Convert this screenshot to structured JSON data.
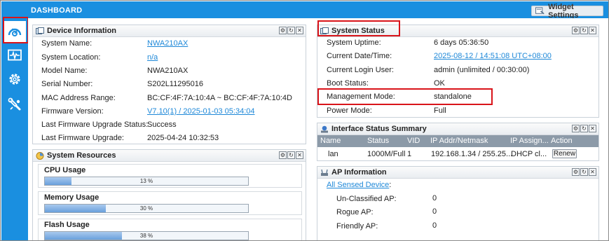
{
  "header": {
    "title": "DASHBOARD",
    "widget_settings_label": "Widget Settings"
  },
  "sidebar": {
    "items": [
      {
        "name": "dashboard",
        "icon": "dashboard-gauge-icon",
        "active": true
      },
      {
        "name": "monitor",
        "icon": "monitor-pulse-icon",
        "active": false
      },
      {
        "name": "configuration",
        "icon": "gear-icon",
        "active": false
      },
      {
        "name": "maintenance",
        "icon": "wrench-icon",
        "active": false
      }
    ]
  },
  "device_info": {
    "title": "Device Information",
    "rows": [
      {
        "label": "System Name:",
        "value": "NWA210AX",
        "link": true
      },
      {
        "label": "System Location:",
        "value": "n/a",
        "link": true
      },
      {
        "label": "Model Name:",
        "value": "NWA210AX",
        "link": false
      },
      {
        "label": "Serial Number:",
        "value": "S202L11295016",
        "link": false
      },
      {
        "label": "MAC Address Range:",
        "value": "BC:CF:4F:7A:10:4A ~ BC:CF:4F:7A:10:4D",
        "link": false
      },
      {
        "label": "Firmware Version:",
        "value": "V7.10(1) / 2025-01-03 05:34:04",
        "link": true
      },
      {
        "label": "Last Firmware Upgrade Status:",
        "value": "Success",
        "link": false
      },
      {
        "label": "Last Firmware Upgrade:",
        "value": "2025-04-24 10:32:53",
        "link": false
      }
    ]
  },
  "system_resources": {
    "title": "System Resources",
    "items": [
      {
        "label": "CPU Usage",
        "percent": 13,
        "text": "13 %"
      },
      {
        "label": "Memory Usage",
        "percent": 30,
        "text": "30 %"
      },
      {
        "label": "Flash Usage",
        "percent": 38,
        "text": "38 %"
      }
    ]
  },
  "system_status": {
    "title": "System Status",
    "rows": [
      {
        "label": "System Uptime:",
        "value": "6 days 05:36:50",
        "link": false
      },
      {
        "label": "Current Date/Time:",
        "value": "2025-08-12 / 14:51:08 UTC+08:00",
        "link": true
      },
      {
        "label": "Current Login User:",
        "value": "admin (unlimited / 00:30:00)",
        "link": false
      },
      {
        "label": "Boot Status:",
        "value": "OK",
        "link": false
      },
      {
        "label": "Management Mode:",
        "value": "standalone",
        "link": false
      },
      {
        "label": "Power Mode:",
        "value": "Full",
        "link": false
      }
    ]
  },
  "interface_status": {
    "title": "Interface Status Summary",
    "columns": [
      "Name",
      "Status",
      "VID",
      "IP Addr/Netmask",
      "IP Assign...",
      "Action"
    ],
    "rows": [
      {
        "name": "lan",
        "status": "1000M/Full",
        "vid": "1",
        "ip": "192.168.1.34 / 255.25...",
        "assign": "DHCP cl...",
        "action": "Renew"
      }
    ]
  },
  "ap_info": {
    "title": "AP Information",
    "link_text": "All Sensed Device",
    "link_suffix": ":",
    "rows": [
      {
        "label": "Un-Classified AP:",
        "value": "0"
      },
      {
        "label": "Rogue AP:",
        "value": "0"
      },
      {
        "label": "Friendly AP:",
        "value": "0"
      }
    ]
  },
  "colors": {
    "accent": "#1a8fe0",
    "highlight": "#d9141a",
    "link": "#1e88d8"
  }
}
